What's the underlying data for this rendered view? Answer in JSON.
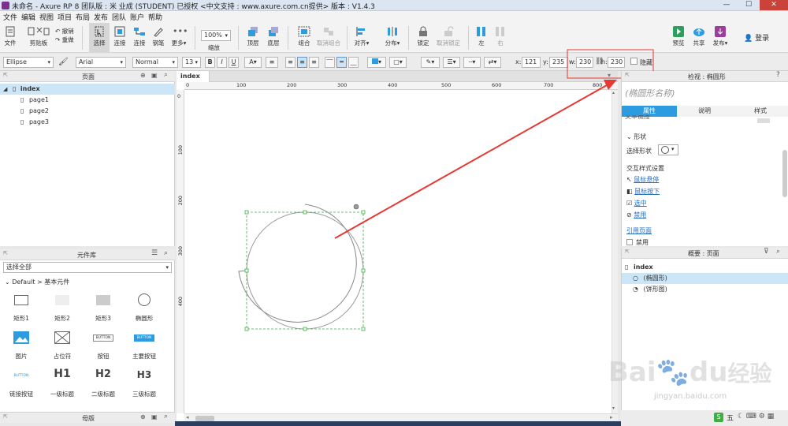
{
  "window": {
    "title": "未命名 - Axure RP 8 团队版 : 米 业成 (STUDENT) 已授权    <中文支持 : www.axure.com.cn提供> 版本 : V1.4.3",
    "min": "—",
    "max": "☐",
    "close": "✕"
  },
  "menu": [
    "文件",
    "编辑",
    "视图",
    "项目",
    "布局",
    "发布",
    "团队",
    "账户",
    "帮助"
  ],
  "toolbar": {
    "file": "文件",
    "clipboard": "剪贴板",
    "undo": "撤销",
    "redo": "重做",
    "select": "选择",
    "connect": "连接",
    "pen": "钢笔",
    "more": "更多",
    "zoom_value": "100%",
    "zoom": "缩放",
    "top": "顶层",
    "bottom": "底层",
    "group": "组合",
    "ungroup": "取消组合",
    "align": "对齐",
    "distribute": "分布",
    "lock": "锁定",
    "unlock": "取消锁定",
    "left": "左",
    "right": "右",
    "preview": "预览",
    "share": "共享",
    "publish": "发布",
    "login": "登录"
  },
  "format": {
    "widget_type": "Ellipse",
    "font": "Arial",
    "style": "Normal",
    "size": "13",
    "bold": "B",
    "italic": "I",
    "underline": "U",
    "x_label": "x:",
    "x": "121",
    "y_label": "y:",
    "y": "235",
    "w_label": "w:",
    "w": "230",
    "h_label": "h:",
    "h": "230",
    "hidden": "隐藏"
  },
  "pages_panel": {
    "title": "页面",
    "root": "index",
    "items": [
      "page1",
      "page2",
      "page3"
    ]
  },
  "library": {
    "title": "元件库",
    "select": "选择全部",
    "category": "Default > 基本元件",
    "items": [
      "矩形1",
      "矩形2",
      "矩形3",
      "椭圆形",
      "图片",
      "占位符",
      "按钮",
      "主要按钮",
      "链接按钮",
      "一级标题",
      "二级标题",
      "三级标题"
    ],
    "button_text": "BUTTON",
    "h1": "H1",
    "h2": "H2",
    "h3": "H3"
  },
  "master": {
    "title": "母版"
  },
  "canvas": {
    "tab": "index",
    "ruler_h": [
      "0",
      "100",
      "200",
      "300",
      "400",
      "500",
      "600",
      "700",
      "800"
    ],
    "ruler_v": [
      "0",
      "100",
      "200",
      "300",
      "400"
    ]
  },
  "inspector": {
    "title": "检视 : 椭圆形",
    "name_placeholder": "(椭圆形名称)",
    "tabs": [
      "属性",
      "说明",
      "样式"
    ],
    "clipped": "文本链接",
    "shape_section": "形状",
    "shape_label": "选择形状",
    "interaction_title": "交互样式设置",
    "interactions": [
      "鼠标悬停",
      "鼠标按下",
      "选中",
      "禁用"
    ],
    "ref_page": "引用页面",
    "disabled": "禁用"
  },
  "outline": {
    "title": "概要 : 页面",
    "root": "index",
    "items": [
      "(椭圆形)",
      "(饼形图)"
    ]
  },
  "status": {
    "ime": "五"
  },
  "watermark": {
    "brand": "Bai",
    "brand2": "du",
    "cn": "经验",
    "url": "jingyan.baidu.com"
  },
  "colors": {
    "accent": "#2d9be0",
    "annotation": "#e53935",
    "selection": "#3cb043"
  }
}
